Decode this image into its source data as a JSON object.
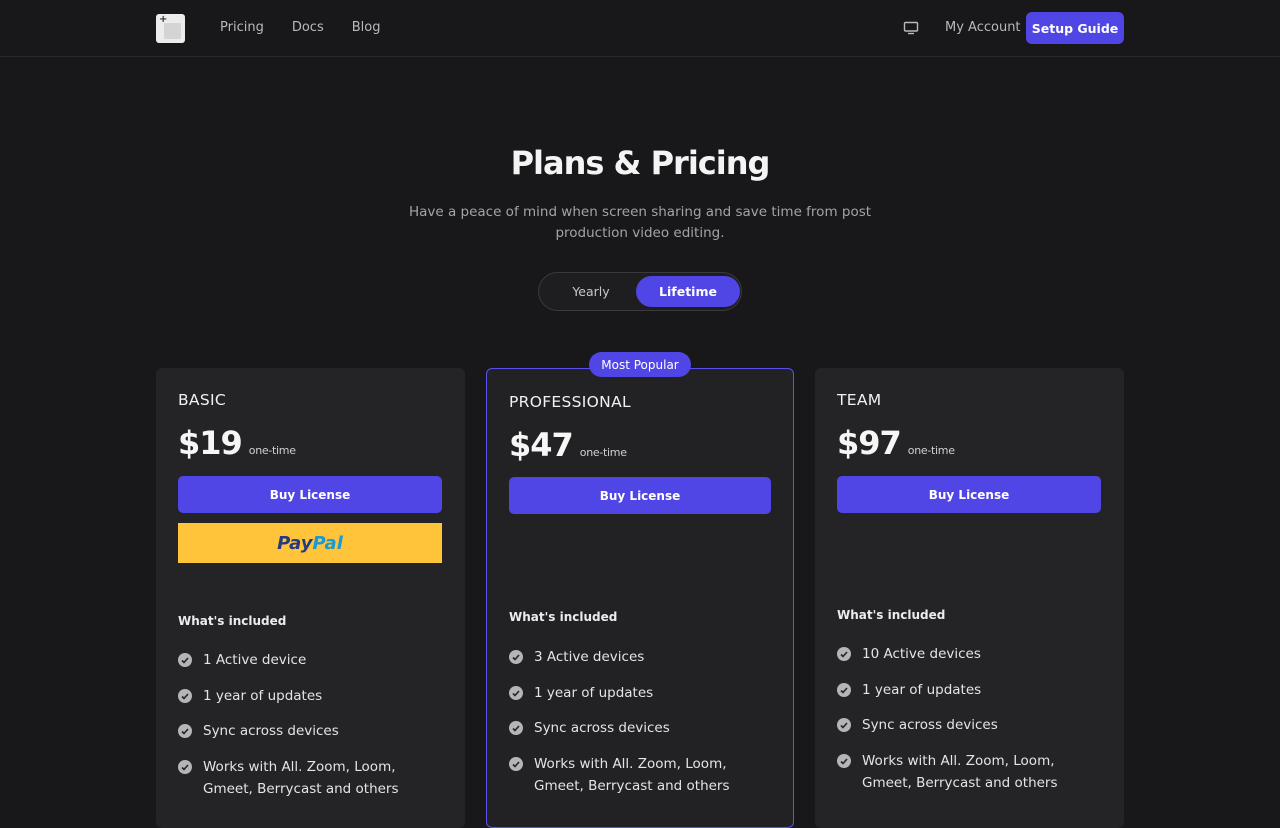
{
  "nav": {
    "links": [
      "Pricing",
      "Docs",
      "Blog"
    ],
    "account_label": "My Account",
    "cta_label": "Setup Guide"
  },
  "hero": {
    "title": "Plans & Pricing",
    "subtitle": "Have a peace of mind when screen sharing and save time from post production video editing.",
    "toggle": {
      "options": [
        "Yearly",
        "Lifetime"
      ],
      "selected": "Lifetime"
    }
  },
  "plans": [
    {
      "name": "BASIC",
      "price": "$19",
      "price_note": "one-time",
      "buy_label": "Buy License",
      "paypal": {
        "part1": "Pay",
        "part2": "Pal"
      },
      "included_label": "What's included",
      "features": [
        "1 Active device",
        "1 year of updates",
        "Sync across devices",
        "Works with All. Zoom, Loom, Gmeet, Berrycast and others"
      ]
    },
    {
      "name": "PROFESSIONAL",
      "badge": "Most Popular",
      "price": "$47",
      "price_note": "one-time",
      "buy_label": "Buy License",
      "included_label": "What's included",
      "features": [
        "3 Active devices",
        "1 year of updates",
        "Sync across devices",
        "Works with All. Zoom, Loom, Gmeet, Berrycast and others"
      ]
    },
    {
      "name": "TEAM",
      "price": "$97",
      "price_note": "one-time",
      "buy_label": "Buy License",
      "included_label": "What's included",
      "features": [
        "10 Active devices",
        "1 year of updates",
        "Sync across devices",
        "Works with All. Zoom, Loom, Gmeet, Berrycast and others"
      ]
    }
  ],
  "colors": {
    "accent": "#4f46e5",
    "background": "#18181a",
    "card": "#242426",
    "paypal_yellow": "#ffc439"
  }
}
